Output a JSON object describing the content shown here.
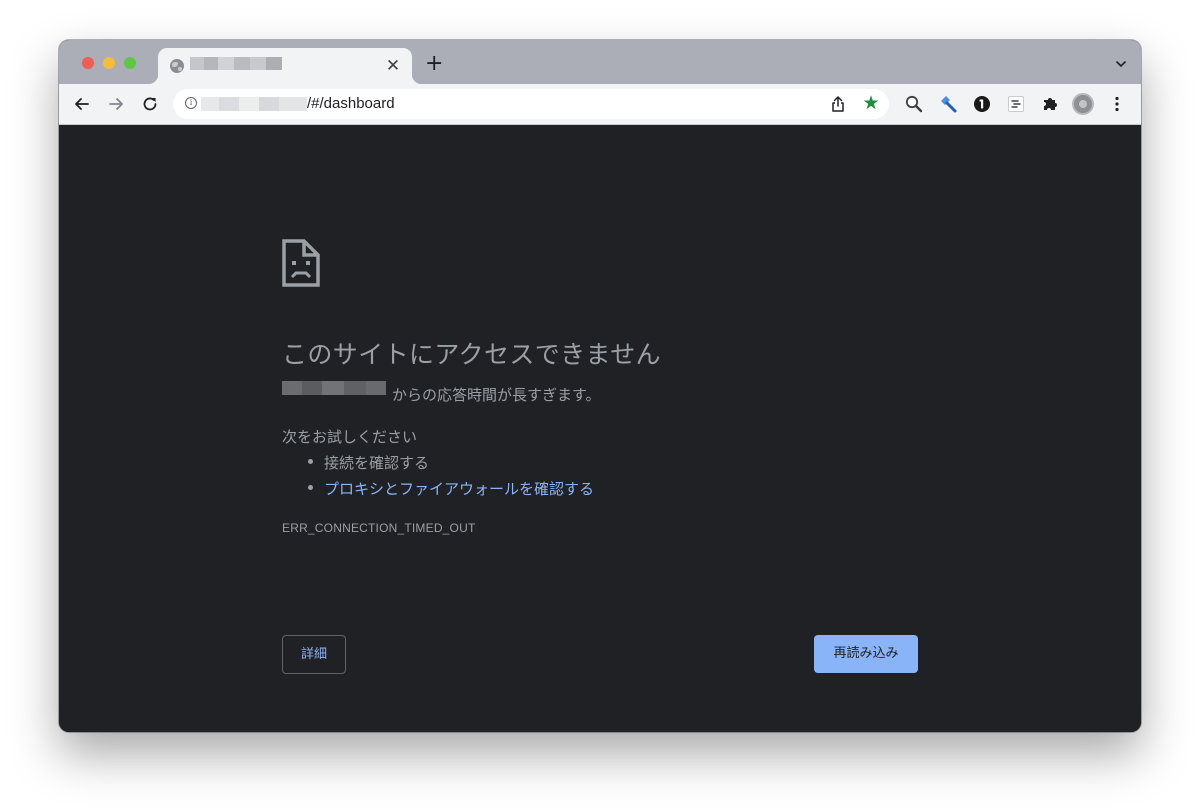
{
  "browser": {
    "tab": {
      "title": "",
      "close_glyph": "✕"
    },
    "new_tab_glyph": "+",
    "address_bar": {
      "url_path": "/#/dashboard"
    },
    "extensions": [
      "search-extension-icon",
      "hammer-extension-icon",
      "1password-icon",
      "list-extension-icon",
      "puzzle-extensions-icon"
    ],
    "bookmark_star_color": "#1e8e3e"
  },
  "error_page": {
    "title": "このサイトにアクセスできません",
    "description": "からの応答時間が長すぎます。",
    "suggestions_title": "次をお試しください",
    "suggestions": [
      {
        "text": "接続を確認する",
        "is_link": false
      },
      {
        "text": "プロキシとファイアウォールを確認する",
        "is_link": true
      }
    ],
    "error_code": "ERR_CONNECTION_TIMED_OUT",
    "details_button": "詳細",
    "reload_button": "再読み込み"
  },
  "colors": {
    "page_background": "#202124",
    "text": "#9aa0a6",
    "link": "#8ab4f8",
    "primary_button": "#8ab4f8"
  }
}
